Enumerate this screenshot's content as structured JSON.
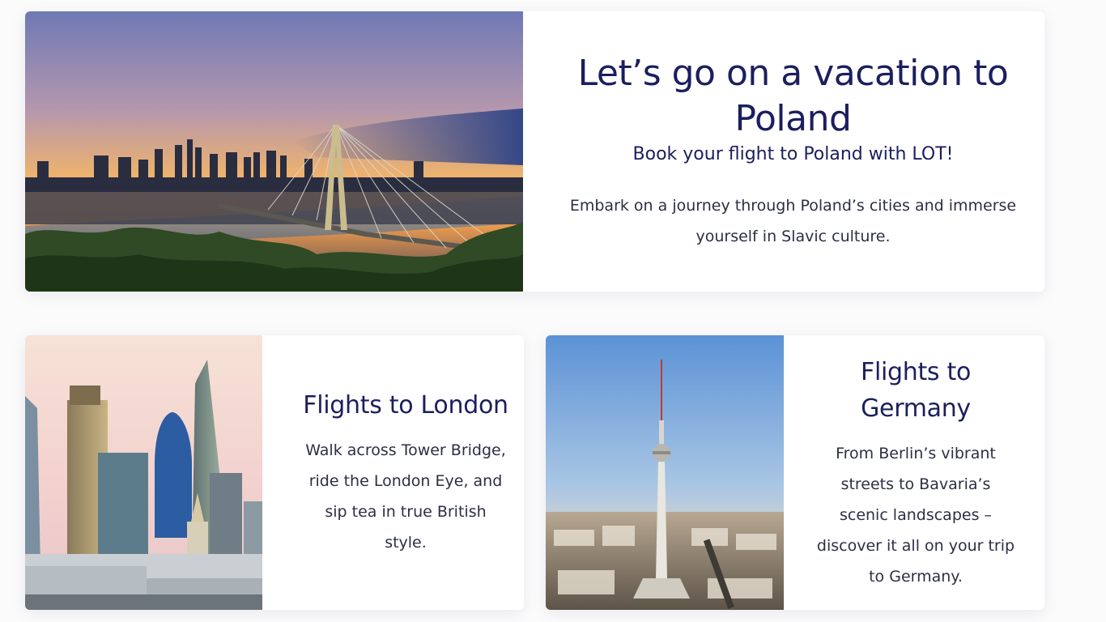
{
  "colors": {
    "heading": "#1b1f5e",
    "body_text": "#2c2f44",
    "card_background": "#ffffff",
    "page_background": "#fbfbfc"
  },
  "poland": {
    "title": "Let’s go on a vacation to Poland",
    "subtitle": "Book your flight to Poland with LOT!",
    "body": "Embark on a journey through Poland’s cities and immerse yourself in Slavic culture."
  },
  "london": {
    "title": "Flights to London",
    "body": "Walk across Tower Bridge, ride the London Eye, and sip tea in true British style."
  },
  "germany": {
    "title": "Flights to Germany",
    "body": "From Berlin’s vibrant streets to Bavaria’s scenic landscapes – discover it all on your trip to Germany."
  }
}
